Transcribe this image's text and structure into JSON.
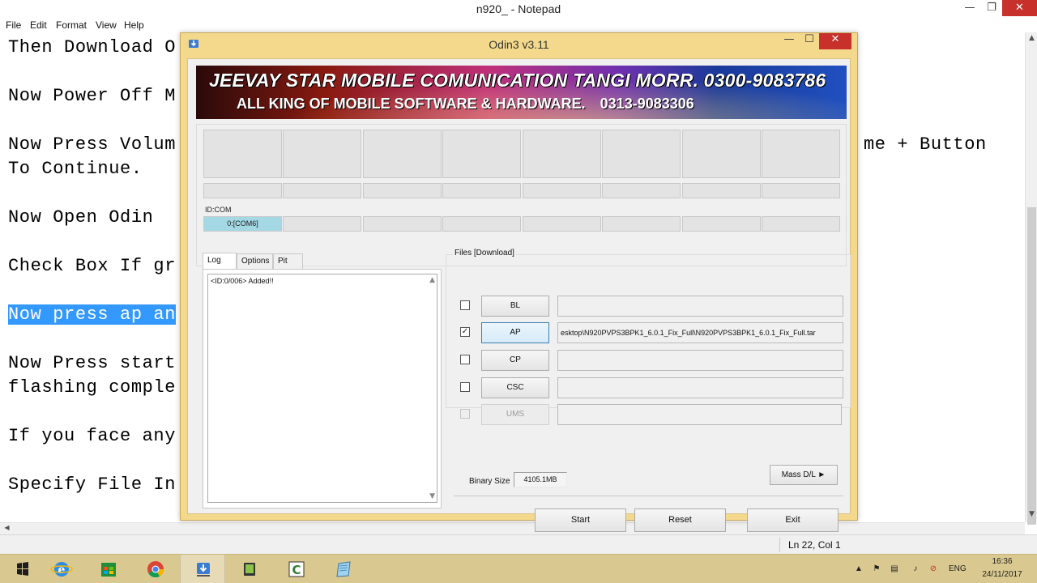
{
  "notepad": {
    "title": "n920_ - Notepad",
    "menu": [
      "File",
      "Edit",
      "Format",
      "View",
      "Help"
    ],
    "lines": [
      "Then Download O",
      "Now Power Off M",
      "Now Press Volum",
      "To Continue.",
      "Now Open Odin",
      "Check Box If gr",
      "Now press ap an",
      "Now Press start",
      "flashing comple",
      "If you face any",
      "Specify File In"
    ],
    "right_fragment": "me + Button",
    "status": "Ln 22, Col 1"
  },
  "odin": {
    "title": "Odin3 v3.11",
    "banner": {
      "line1": "JEEVAY STAR MOBILE COMUNICATION TANGI MORR. 0300-9083786",
      "line2": "ALL KING OF MOBILE SOFTWARE & HARDWARE.",
      "line2_phone": "0313-9083306"
    },
    "id_com_label": "ID:COM",
    "com_port": "0:[COM6]",
    "tabs": [
      "Log",
      "Options",
      "Pit"
    ],
    "log_text": "<ID:0/006> Added!!",
    "files_label": "Files [Download]",
    "files": [
      {
        "label": "BL",
        "checked": false,
        "enabled": true,
        "path": ""
      },
      {
        "label": "AP",
        "checked": true,
        "enabled": true,
        "path": "esktop\\N920PVPS3BPK1_6.0.1_Fix_Full\\N920PVPS3BPK1_6.0.1_Fix_Full.tar"
      },
      {
        "label": "CP",
        "checked": false,
        "enabled": true,
        "path": ""
      },
      {
        "label": "CSC",
        "checked": false,
        "enabled": true,
        "path": ""
      },
      {
        "label": "UMS",
        "checked": false,
        "enabled": false,
        "path": ""
      }
    ],
    "check_mark": "✓",
    "binary_size_label": "Binary Size",
    "binary_size_value": "4105.1MB",
    "mass_dl_label": "Mass D/L ►",
    "start_label": "Start",
    "reset_label": "Reset",
    "exit_label": "Exit"
  },
  "taskbar": {
    "items": [
      "start-button",
      "internet-explorer-icon",
      "store-icon",
      "chrome-icon",
      "odin-icon",
      "android-icon",
      "camtasia-icon",
      "notepad-icon"
    ],
    "lang": "ENG",
    "time": "16:36",
    "date": "24/11/2017"
  }
}
